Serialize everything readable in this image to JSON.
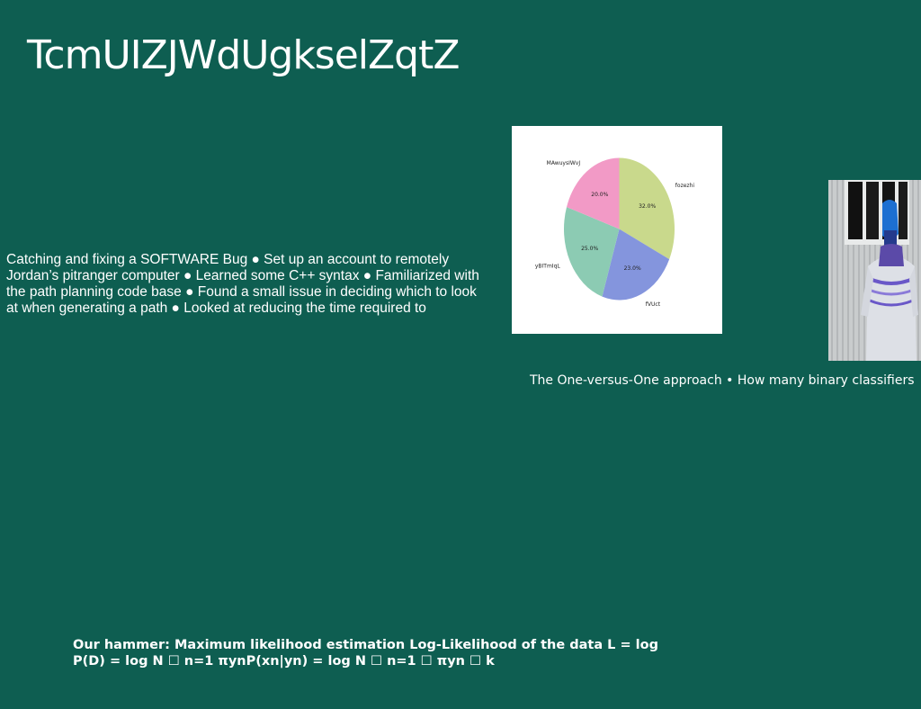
{
  "slide": {
    "title": "TcmUIZJWdUgkselZqtZ",
    "body_text": "Catching and fixing a SOFTWARE Bug ● Set up an account to remotely Jordan’s pitranger computer ● Learned some C++ syntax ● Familiarized with the path planning code base ● Found a small issue in deciding which to look at when generating a path ● Looked at reducing the time required to",
    "caption_text": "The One-versus-One approach • How many binary classifiers",
    "formula_text": "Our hammer: Maximum likelihood estimation Log-Likelihood of the data L = log P(D) = log N ☐ n=1 πynP(xn|yn) = log N ☐ n=1 ☐ πyn ☐ k",
    "photo_icon": "person-photo-icon",
    "colors": {
      "background": "#0e5e51",
      "text": "#ffffff"
    }
  },
  "chart_data": {
    "type": "pie",
    "title": "",
    "slices": [
      {
        "label": "fozezhi",
        "value": 32.0,
        "pct_label": "32.0%",
        "color": "#c9d98c"
      },
      {
        "label": "fVUct",
        "value": 23.0,
        "pct_label": "23.0%",
        "color": "#8495dd"
      },
      {
        "label": "yBITmIqL",
        "value": 25.0,
        "pct_label": "25.0%",
        "color": "#8ccbb3"
      },
      {
        "label": "MAwuysIWvJ",
        "value": 20.0,
        "pct_label": "20.0%",
        "color": "#f29ac6"
      }
    ],
    "start_angle_deg": 90,
    "direction": "clockwise"
  }
}
